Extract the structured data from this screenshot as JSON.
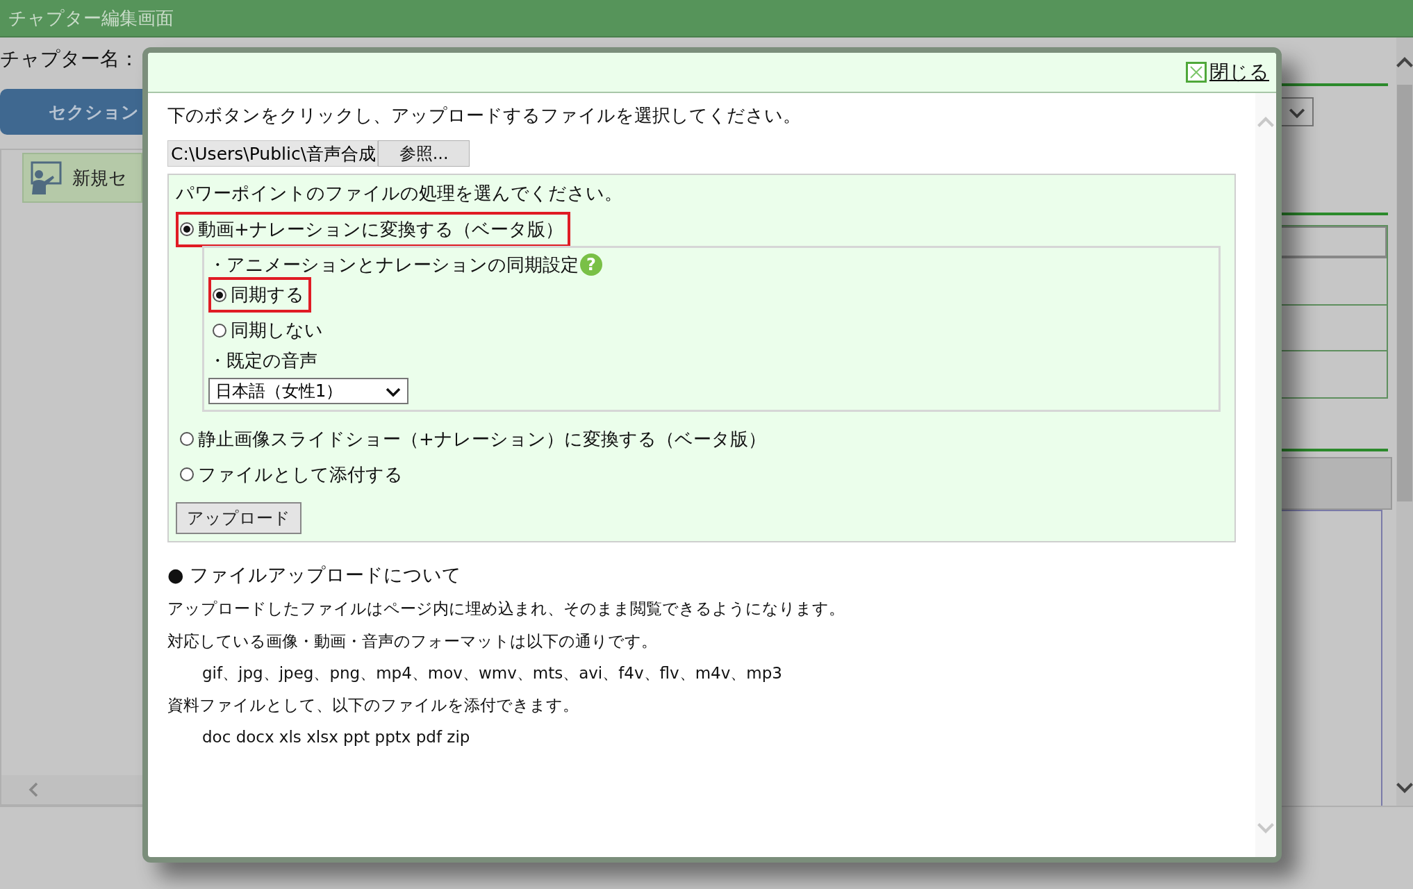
{
  "window": {
    "title": "チャプター編集画面"
  },
  "background": {
    "chapter_name_label": "チャプター名：",
    "section_button": "セクション",
    "section_item": "新規セ"
  },
  "dialog": {
    "close_link": "閉じる",
    "instruction": "下のボタンをクリックし、アップロードするファイルを選択してください。",
    "file_path": "C:\\Users\\Public\\音声合成",
    "browse_button": "参照...",
    "processing_prompt": "パワーポイントのファイルの処理を選んでください。",
    "options": [
      {
        "label": "動画+ナレーションに変換する（ベータ版）",
        "selected": true,
        "highlighted": true,
        "details": {
          "sync_heading": "・アニメーションとナレーションの同期設定",
          "help_mark": "?",
          "sync_options": [
            {
              "label": "同期する",
              "selected": true,
              "highlighted": true
            },
            {
              "label": "同期しない",
              "selected": false,
              "highlighted": false
            }
          ],
          "voice_heading": "・既定の音声",
          "voice_select": "日本語（女性1）"
        }
      },
      {
        "label": "静止画像スライドショー（+ナレーション）に変換する（ベータ版）",
        "selected": false,
        "highlighted": false
      },
      {
        "label": "ファイルとして添付する",
        "selected": false,
        "highlighted": false
      }
    ],
    "upload_button": "アップロード",
    "about": {
      "heading": "● ファイルアップロードについて",
      "lines": [
        {
          "text": "アップロードしたファイルはページ内に埋め込まれ、そのまま閲覧できるようになります。",
          "indented": false
        },
        {
          "text": "対応している画像・動画・音声のフォーマットは以下の通りです。",
          "indented": false
        },
        {
          "text": "gif、jpg、jpeg、png、mp4、mov、wmv、mts、avi、f4v、flv、m4v、mp3",
          "indented": true
        },
        {
          "text": "資料ファイルとして、以下のファイルを添付できます。",
          "indented": false
        },
        {
          "text": "doc docx xls xlsx ppt pptx pdf zip",
          "indented": true
        }
      ]
    }
  }
}
